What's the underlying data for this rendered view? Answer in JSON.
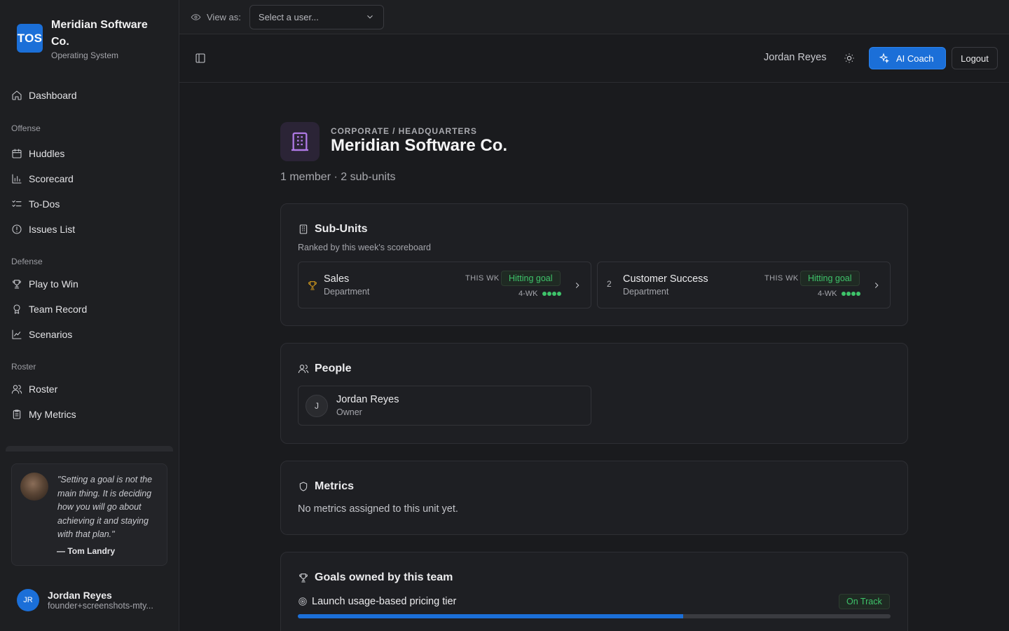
{
  "brand": {
    "logo": "TOS",
    "name": "Meridian Software Co.",
    "subtitle": "Operating System"
  },
  "sidebar": {
    "dashboard": {
      "label": "Dashboard",
      "icon": "home-icon"
    },
    "sections": [
      {
        "title": "Offense",
        "items": [
          {
            "label": "Huddles",
            "icon": "calendar-icon"
          },
          {
            "label": "Scorecard",
            "icon": "bar-chart-icon"
          },
          {
            "label": "To-Dos",
            "icon": "list-checks-icon"
          },
          {
            "label": "Issues List",
            "icon": "alert-circle-icon"
          }
        ]
      },
      {
        "title": "Defense",
        "items": [
          {
            "label": "Play to Win",
            "icon": "trophy-icon"
          },
          {
            "label": "Team Record",
            "icon": "award-icon"
          },
          {
            "label": "Scenarios",
            "icon": "line-chart-icon"
          }
        ]
      },
      {
        "title": "Roster",
        "items": [
          {
            "label": "Roster",
            "icon": "users-icon"
          },
          {
            "label": "My Metrics",
            "icon": "clipboard-icon"
          }
        ]
      }
    ],
    "quote": {
      "text": "\"Setting a goal is not the main thing. It is deciding how you will go about achieving it and staying with that plan.\"",
      "author": "— Tom Landry"
    },
    "user": {
      "initials": "JR",
      "name": "Jordan Reyes",
      "email": "founder+screenshots-mty..."
    }
  },
  "viewas": {
    "label": "View as:",
    "placeholder": "Select a user..."
  },
  "header": {
    "user_name": "Jordan Reyes",
    "ai_label": "AI Coach",
    "logout_label": "Logout"
  },
  "unit": {
    "breadcrumb": "CORPORATE / HEADQUARTERS",
    "title": "Meridian Software Co.",
    "meta": "1 member · 2 sub-units"
  },
  "subunits": {
    "title": "Sub-Units",
    "subtitle": "Ranked by this week's scoreboard",
    "items": [
      {
        "rank": "1",
        "name": "Sales",
        "type": "Department",
        "this_wk_label": "THIS WK",
        "status": "Hitting goal",
        "four_wk_label": "4-WK",
        "four_wk_dots": 4
      },
      {
        "rank": "2",
        "name": "Customer Success",
        "type": "Department",
        "this_wk_label": "THIS WK",
        "status": "Hitting goal",
        "four_wk_label": "4-WK",
        "four_wk_dots": 4
      }
    ]
  },
  "people": {
    "title": "People",
    "items": [
      {
        "initial": "J",
        "name": "Jordan Reyes",
        "role": "Owner"
      }
    ]
  },
  "metrics": {
    "title": "Metrics",
    "empty": "No metrics assigned to this unit yet."
  },
  "goals": {
    "title": "Goals owned by this team",
    "items": [
      {
        "name": "Launch usage-based pricing tier",
        "status": "On Track",
        "progress": 0.65
      }
    ]
  },
  "colors": {
    "accent": "#1b6fd8",
    "success": "#3ec36a",
    "unit_icon": "#b07ae6",
    "trophy": "#d19a1d"
  }
}
